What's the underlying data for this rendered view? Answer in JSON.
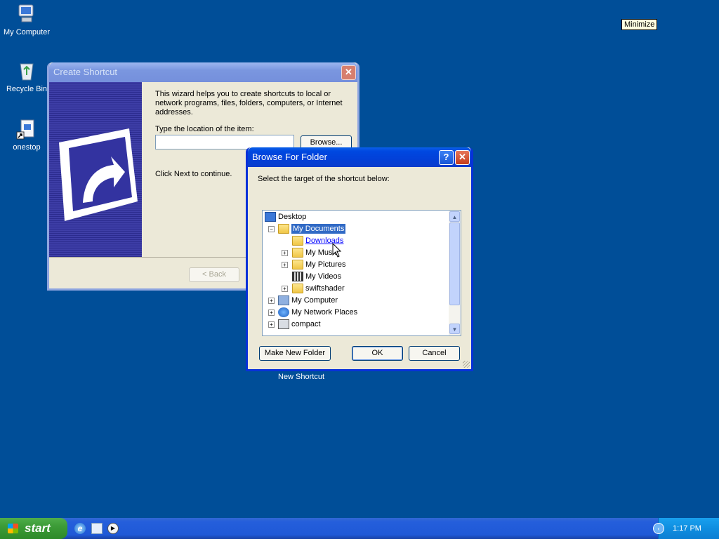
{
  "desktop": {
    "icons": [
      {
        "label": "My Computer",
        "icon": "my-computer-icon"
      },
      {
        "label": "Recycle Bin",
        "icon": "recycle-bin-icon"
      },
      {
        "label": "onestop",
        "icon": "shortcut-file-icon"
      }
    ],
    "new_shortcut_label": "New Shortcut"
  },
  "tooltip": {
    "text": "Minimize"
  },
  "create_shortcut": {
    "title": "Create Shortcut",
    "intro": "This wizard helps you to create shortcuts to local or network programs, files, folders, computers, or Internet addresses.",
    "location_label": "Type the location of the item:",
    "location_value": "",
    "browse_label": "Browse...",
    "continue_text": "Click Next to continue.",
    "back_label": "< Back"
  },
  "browse_folder": {
    "title": "Browse For Folder",
    "help_label": "?",
    "instruction": "Select the target of the shortcut below:",
    "tree": [
      {
        "label": "Desktop",
        "icon": "desktop-icon"
      },
      {
        "label": "My Documents",
        "icon": "my-documents-icon",
        "expanded": true,
        "selected": true
      },
      {
        "label": "Downloads",
        "icon": "folder-icon",
        "hover": true
      },
      {
        "label": "My Music",
        "icon": "music-folder-icon"
      },
      {
        "label": "My Pictures",
        "icon": "pictures-folder-icon"
      },
      {
        "label": "My Videos",
        "icon": "videos-folder-icon"
      },
      {
        "label": "swiftshader",
        "icon": "folder-icon"
      },
      {
        "label": "My Computer",
        "icon": "my-computer-icon"
      },
      {
        "label": "My Network Places",
        "icon": "network-places-icon"
      },
      {
        "label": "compact",
        "icon": "compact-icon"
      }
    ],
    "make_new_folder_label": "Make New Folder",
    "ok_label": "OK",
    "cancel_label": "Cancel"
  },
  "taskbar": {
    "start_label": "start",
    "quick_launch": [
      "internet-explorer-icon",
      "desktop-show-icon",
      "media-player-icon"
    ],
    "clock": "1:17 PM"
  },
  "colors": {
    "desktop": "#004e98",
    "titlebar_active": "#0a5fe8",
    "selection": "#316ac5",
    "link": "#0000ff"
  }
}
